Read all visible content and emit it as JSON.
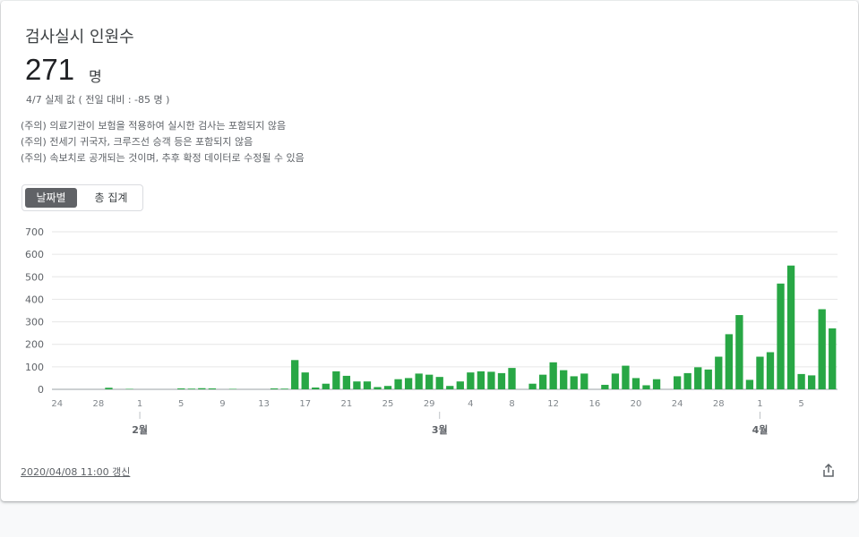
{
  "card": {
    "title": "검사실시 인원수",
    "value": "271",
    "unit": "명",
    "subline": "4/7 실제 값 ( 전일 대비 : -85 명 )",
    "notes": [
      "(주의) 의료기관이 보험을 적용하여 실시한 검사는 포함되지 않음",
      "(주의) 전세기 귀국자, 크루즈선 승객 등은 포함되지 않음",
      "(주의) 속보치로 공개되는 것이며, 추후 확정 데이터로 수정될 수 있음"
    ],
    "toggle": {
      "daily_label": "날짜별",
      "total_label": "총 집계"
    },
    "updated": "2020/04/08 11:00 갱신",
    "share_icon": "share-icon",
    "bar_color": "#28a745"
  },
  "chart_data": {
    "type": "bar",
    "title": "",
    "xlabel": "",
    "ylabel": "",
    "ylim": [
      0,
      700
    ],
    "yticks": [
      "0",
      "100",
      "200",
      "300",
      "400",
      "500",
      "600",
      "700"
    ],
    "grid": true,
    "categories": [
      "1/24",
      "1/25",
      "1/26",
      "1/27",
      "1/28",
      "1/29",
      "1/30",
      "1/31",
      "2/1",
      "2/2",
      "2/3",
      "2/4",
      "2/5",
      "2/6",
      "2/7",
      "2/8",
      "2/9",
      "2/10",
      "2/11",
      "2/12",
      "2/13",
      "2/14",
      "2/15",
      "2/16",
      "2/17",
      "2/18",
      "2/19",
      "2/20",
      "2/21",
      "2/22",
      "2/23",
      "2/24",
      "2/25",
      "2/26",
      "2/27",
      "2/28",
      "2/29",
      "3/1",
      "3/2",
      "3/3",
      "3/4",
      "3/5",
      "3/6",
      "3/7",
      "3/8",
      "3/9",
      "3/10",
      "3/11",
      "3/12",
      "3/13",
      "3/14",
      "3/15",
      "3/16",
      "3/17",
      "3/18",
      "3/19",
      "3/20",
      "3/21",
      "3/22",
      "3/23",
      "3/24",
      "3/25",
      "3/26",
      "3/27",
      "3/28",
      "3/29",
      "3/30",
      "3/31",
      "4/1",
      "4/2",
      "4/3",
      "4/4",
      "4/5",
      "4/6",
      "4/7"
    ],
    "values": [
      0,
      0,
      0,
      0,
      0,
      7,
      0,
      2,
      0,
      0,
      0,
      0,
      4,
      3,
      5,
      4,
      0,
      2,
      0,
      0,
      0,
      4,
      3,
      130,
      75,
      8,
      25,
      80,
      60,
      35,
      35,
      10,
      15,
      45,
      50,
      70,
      65,
      55,
      15,
      35,
      75,
      80,
      78,
      72,
      95,
      0,
      25,
      65,
      120,
      85,
      58,
      70,
      0,
      20,
      70,
      105,
      50,
      18,
      45,
      0,
      58,
      72,
      98,
      88,
      145,
      245,
      330,
      42,
      145,
      165,
      470,
      550,
      68,
      62,
      356,
      271
    ],
    "x_tick_labels": [
      "24",
      "28",
      "1",
      "5",
      "9",
      "13",
      "17",
      "21",
      "25",
      "29",
      "4",
      "8",
      "12",
      "16",
      "20",
      "24",
      "28",
      "1",
      "5"
    ],
    "month_labels": [
      "2월",
      "3월",
      "4월"
    ]
  }
}
